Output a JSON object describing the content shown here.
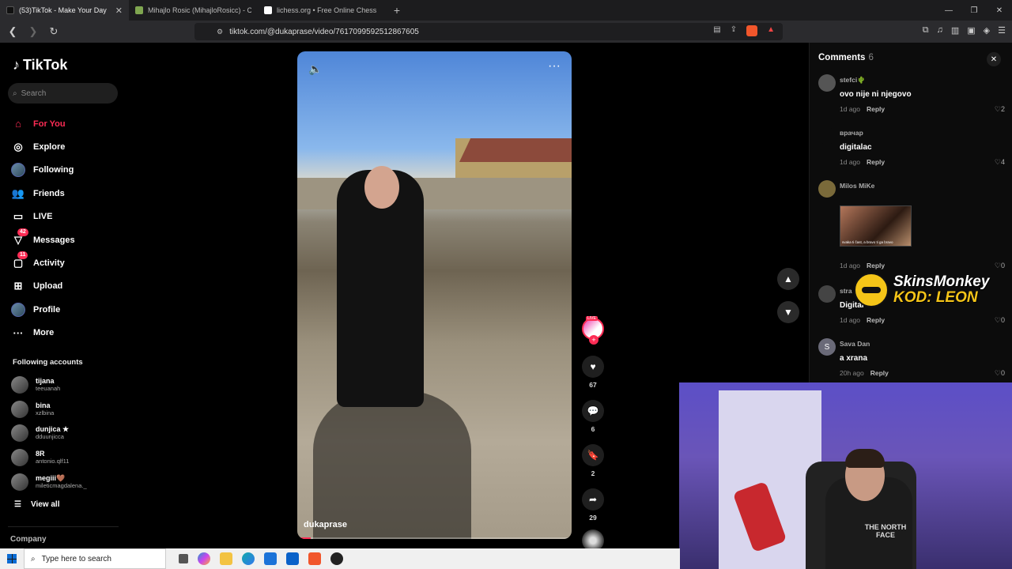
{
  "browser": {
    "tabs": [
      {
        "title": "(53)TikTok - Make Your Day",
        "active": true,
        "color": "#111111"
      },
      {
        "title": "Mihajlo Rosic (MihajloRosicc) - Chess",
        "active": false,
        "color": "#7fa650"
      },
      {
        "title": "lichess.org • Free Online Chess",
        "active": false,
        "color": "#ffffff"
      }
    ],
    "url": "tiktok.com/@dukaprase/video/7617099592512867605"
  },
  "sidebar": {
    "logo": "TikTok",
    "search_placeholder": "Search",
    "nav": [
      {
        "label": "For You",
        "icon": "home-icon",
        "glyph": "⌂",
        "active": true
      },
      {
        "label": "Explore",
        "icon": "compass-icon",
        "glyph": "◎"
      },
      {
        "label": "Following",
        "icon": "avatar",
        "glyph": ""
      },
      {
        "label": "Friends",
        "icon": "friends-icon",
        "glyph": "👥"
      },
      {
        "label": "LIVE",
        "icon": "live-icon",
        "glyph": "▭"
      },
      {
        "label": "Messages",
        "icon": "messages-icon",
        "glyph": "▽",
        "badge": "42"
      },
      {
        "label": "Activity",
        "icon": "activity-icon",
        "glyph": "▢",
        "badge": "11"
      },
      {
        "label": "Upload",
        "icon": "upload-icon",
        "glyph": "⊞"
      },
      {
        "label": "Profile",
        "icon": "avatar",
        "glyph": ""
      },
      {
        "label": "More",
        "icon": "more-icon",
        "glyph": "···"
      }
    ],
    "following_title": "Following accounts",
    "accounts": [
      {
        "name": "tijana",
        "handle": "teeuanah"
      },
      {
        "name": "bina",
        "handle": "xzlbina"
      },
      {
        "name": "dunjica ★",
        "handle": "dduunjicca"
      },
      {
        "name": "8R",
        "handle": "antonio.qlf11"
      },
      {
        "name": "megiii🤎",
        "handle": "mileticmagdalena._"
      }
    ],
    "view_all": "View all",
    "company": "Company"
  },
  "video": {
    "author": "dukaprase",
    "progress_fraction": 0.05,
    "likes": "67",
    "comments": "6",
    "saves": "2",
    "shares": "29",
    "live_badge": "LIVE"
  },
  "comments_panel": {
    "title": "Comments",
    "count": "6",
    "items": [
      {
        "user": "stefci🌵",
        "text": "ovo nije ni njegovo",
        "time": "1d ago",
        "reply": "Reply",
        "likes": "2"
      },
      {
        "user": "врачар",
        "text": "digitalac",
        "time": "1d ago",
        "reply": "Reply",
        "likes": "4"
      },
      {
        "user": "Milos MiKe",
        "text": "",
        "time": "1d ago",
        "reply": "Reply",
        "likes": "0",
        "gif_caption": "svaka ti čast, a bravo ti ga bravo"
      },
      {
        "user": "stra",
        "text": "Digital",
        "time": "1d ago",
        "reply": "Reply",
        "likes": "0"
      },
      {
        "user": "Sava Dan",
        "text": "a xrana",
        "time": "20h ago",
        "reply": "Reply",
        "likes": "0",
        "initial": "S"
      }
    ]
  },
  "overlay": {
    "sponsor_line1": "SkinsMonkey",
    "sponsor_line2": "KOD: LEON",
    "shirt_text": "THE NORTH FACE"
  },
  "taskbar": {
    "search_placeholder": "Type here to search"
  },
  "colors": {
    "accent": "#fe2c55",
    "sponsor": "#f5c518"
  }
}
